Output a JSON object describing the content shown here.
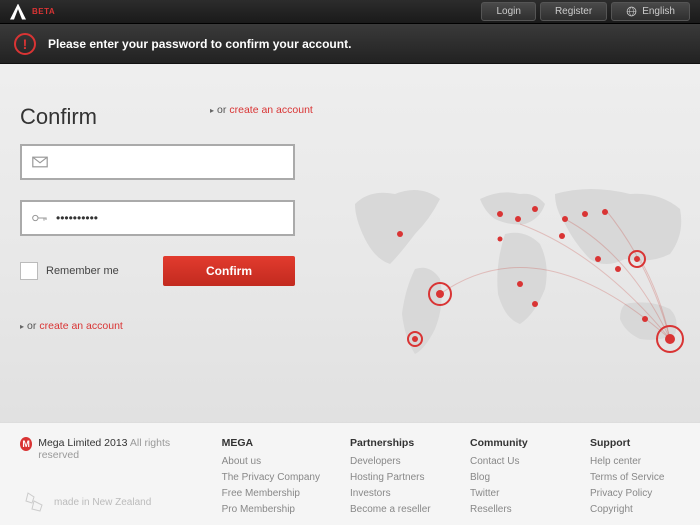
{
  "header": {
    "beta": "BETA",
    "login": "Login",
    "register": "Register",
    "language": "English"
  },
  "alert": {
    "text": "Please enter your password to confirm your account."
  },
  "form": {
    "title": "Confirm",
    "or": "or",
    "create_link": "create an account",
    "email_value": "",
    "password_value": "••••••••••",
    "remember_label": "Remember me",
    "confirm_btn": "Confirm"
  },
  "footer": {
    "company": "Mega Limited 2013",
    "rights": " All rights reserved",
    "made_in": "made in New Zealand",
    "cols": [
      {
        "title": "MEGA",
        "links": [
          "About us",
          "The Privacy Company",
          "Free Membership",
          "Pro Membership"
        ]
      },
      {
        "title": "Partnerships",
        "links": [
          "Developers",
          "Hosting Partners",
          "Investors",
          "Become a reseller"
        ]
      },
      {
        "title": "Community",
        "links": [
          "Contact Us",
          "Blog",
          "Twitter",
          "Resellers"
        ]
      },
      {
        "title": "Support",
        "links": [
          "Help center",
          "Terms of Service",
          "Privacy Policy",
          "Copyright"
        ]
      }
    ]
  }
}
